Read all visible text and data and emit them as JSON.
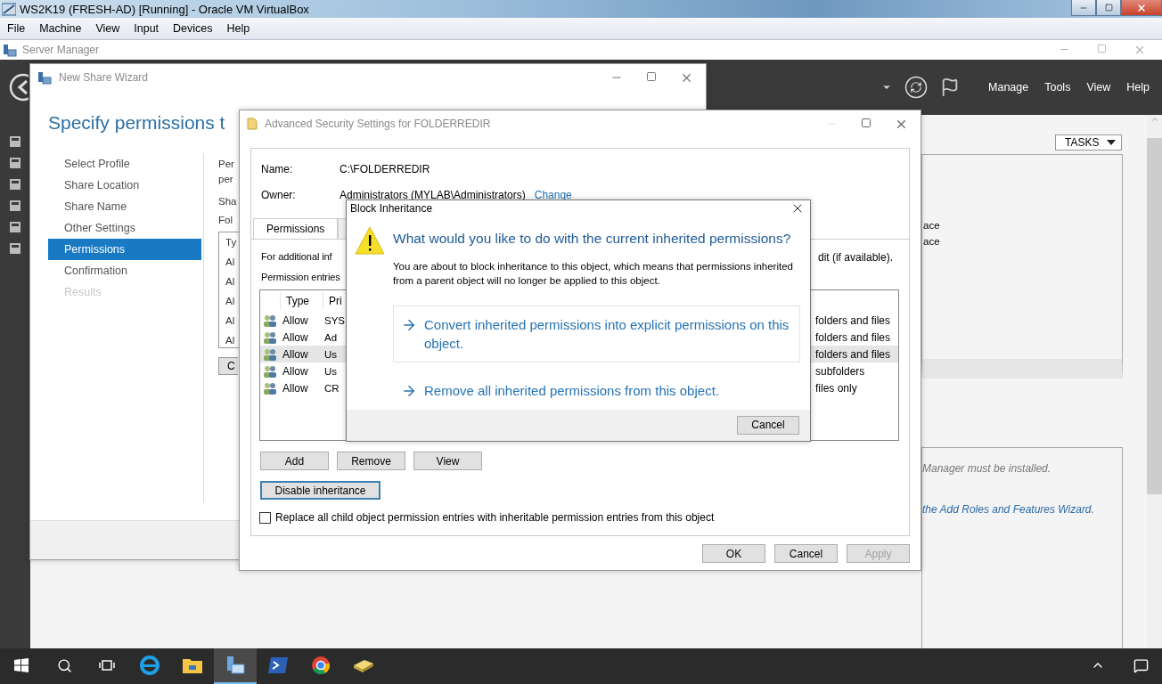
{
  "vbox": {
    "title": "WS2K19 (FRESH-AD) [Running] - Oracle VM VirtualBox",
    "menu": [
      "File",
      "Machine",
      "View",
      "Input",
      "Devices",
      "Help"
    ]
  },
  "server_manager": {
    "title": "Server Manager",
    "menu": [
      "Manage",
      "Tools",
      "View",
      "Help"
    ],
    "tasks": "TASKS",
    "fragments": [
      "ace",
      "ace"
    ],
    "note": "Manager must be installed.",
    "link": "the Add Roles and Features Wizard."
  },
  "wizard": {
    "title": "New Share Wizard",
    "heading": "Specify permissions t",
    "steps": [
      {
        "label": "Select Profile",
        "selected": false,
        "disabled": false
      },
      {
        "label": "Share Location",
        "selected": false,
        "disabled": false
      },
      {
        "label": "Share Name",
        "selected": false,
        "disabled": false
      },
      {
        "label": "Other Settings",
        "selected": false,
        "disabled": false
      },
      {
        "label": "Permissions",
        "selected": true,
        "disabled": false
      },
      {
        "label": "Confirmation",
        "selected": false,
        "disabled": false
      },
      {
        "label": "Results",
        "selected": false,
        "disabled": true
      }
    ],
    "fragments": [
      "Per",
      "per",
      "Sha",
      "Fol"
    ],
    "table_header": "Ty",
    "rows": [
      "Al",
      "Al",
      "Al",
      "Al",
      "Al"
    ],
    "button": "C"
  },
  "advanced": {
    "title": "Advanced Security Settings for FOLDERREDIR",
    "name_label": "Name:",
    "name": "C:\\FOLDERREDIR",
    "owner_label": "Owner:",
    "owner": "Administrators (MYLAB\\Administrators)",
    "change": "Change",
    "tabs": [
      {
        "label": "Permissions",
        "selected": true
      }
    ],
    "info": "For additional inf",
    "info_end": "dit (if available).",
    "entries_label": "Permission entries",
    "columns": [
      "Type",
      "Pri"
    ],
    "rows": [
      {
        "type": "Allow",
        "principal": "SYS",
        "applies": "folders and files",
        "selected": false
      },
      {
        "type": "Allow",
        "principal": "Ad",
        "applies": "folders and files",
        "selected": false
      },
      {
        "type": "Allow",
        "principal": "Us",
        "applies": "folders and files",
        "selected": true
      },
      {
        "type": "Allow",
        "principal": "Us",
        "applies": "subfolders",
        "selected": false
      },
      {
        "type": "Allow",
        "principal": "CR",
        "applies": "files only",
        "selected": false
      }
    ],
    "buttons": [
      "Add",
      "Remove",
      "View"
    ],
    "disable": "Disable inheritance",
    "replace": {
      "label": "Replace all child object permission entries with inheritable permission entries from this object",
      "checked": false
    },
    "footer": [
      {
        "label": "OK",
        "disabled": false
      },
      {
        "label": "Cancel",
        "disabled": false
      },
      {
        "label": "Apply",
        "disabled": true
      }
    ]
  },
  "dialog": {
    "title": "Block Inheritance",
    "question": "What would you like to do with the current inherited permissions?",
    "body": "You are about to block inheritance to this object, which means that permissions inherited from a parent object will no longer be applied to this object.",
    "options": [
      {
        "label": "Convert inherited permissions into explicit permissions on this object.",
        "selected": true
      },
      {
        "label": "Remove all inherited permissions from this object.",
        "selected": false
      }
    ],
    "cancel": "Cancel"
  }
}
